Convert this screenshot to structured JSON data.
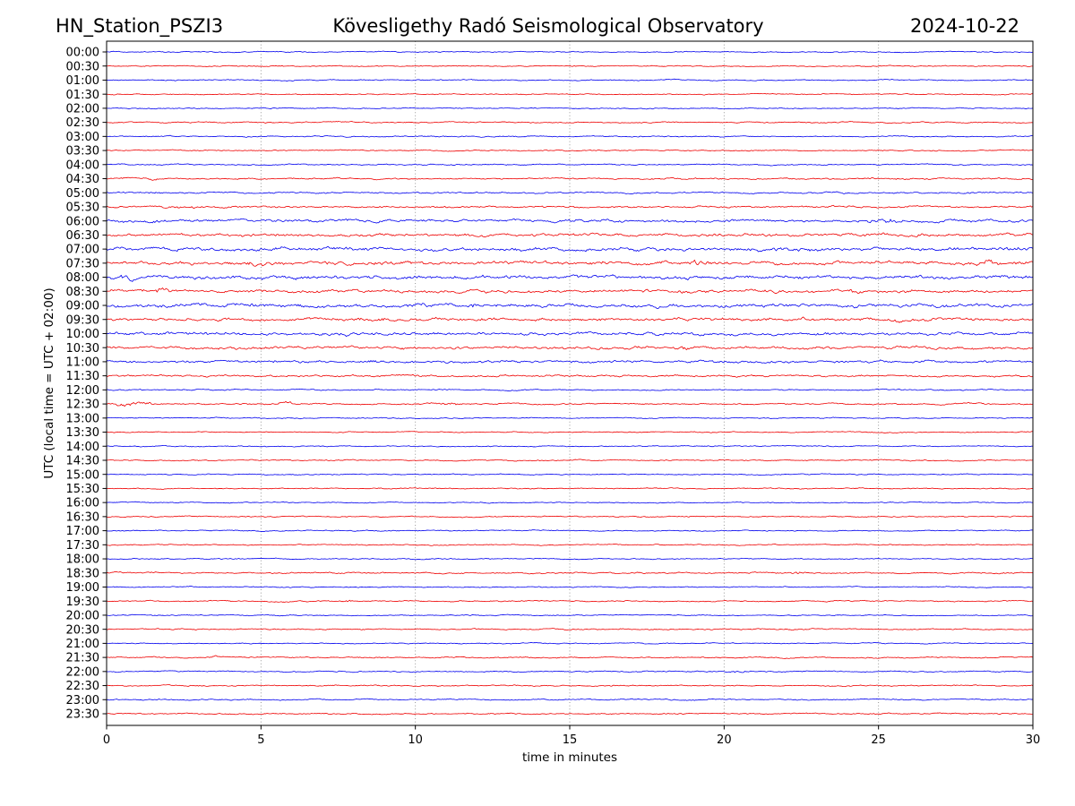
{
  "header": {
    "station": "HN_Station_PSZI3",
    "observatory": "Kövesligethy Radó Seismological Observatory",
    "date": "2024-10-22"
  },
  "chart_data": {
    "type": "line",
    "subtype": "helicorder_day_plot",
    "title": "Kövesligethy Radó Seismological Observatory",
    "station": "HN_Station_PSZI3",
    "date": "2024-10-22",
    "xlabel": "time in minutes",
    "ylabel": "UTC (local time = UTC + 02:00)",
    "xlim": [
      0,
      30
    ],
    "x_ticks": [
      0,
      5,
      10,
      15,
      20,
      25,
      30
    ],
    "minutes_per_row": 30,
    "grid": {
      "vertical": true,
      "style": "dotted",
      "positions_min": [
        5,
        10,
        15,
        20,
        25
      ]
    },
    "legend": "none",
    "colors": {
      "trace_even": "#0000ee",
      "trace_odd": "#ee0000",
      "grid": "#8c8c8c",
      "axis": "#000000",
      "text": "#000000",
      "background": "#ffffff"
    },
    "amplitude_note": "amp = relative noise amplitude (px); bursts = transient events at t minutes",
    "rows": [
      {
        "label": "00:00",
        "color": "blue",
        "amp": 0.6,
        "bursts": []
      },
      {
        "label": "00:30",
        "color": "red",
        "amp": 0.6,
        "bursts": []
      },
      {
        "label": "01:00",
        "color": "blue",
        "amp": 0.65,
        "bursts": []
      },
      {
        "label": "01:30",
        "color": "red",
        "amp": 0.6,
        "bursts": []
      },
      {
        "label": "02:00",
        "color": "blue",
        "amp": 0.6,
        "bursts": []
      },
      {
        "label": "02:30",
        "color": "red",
        "amp": 0.65,
        "bursts": []
      },
      {
        "label": "03:00",
        "color": "blue",
        "amp": 0.65,
        "bursts": []
      },
      {
        "label": "03:30",
        "color": "red",
        "amp": 0.65,
        "bursts": []
      },
      {
        "label": "04:00",
        "color": "blue",
        "amp": 0.7,
        "bursts": [
          {
            "t": 19.5,
            "dur": 0.3,
            "amp": 1.8
          }
        ]
      },
      {
        "label": "04:30",
        "color": "red",
        "amp": 0.85,
        "bursts": [
          {
            "t": 1.4,
            "dur": 0.5,
            "amp": 1.8
          }
        ]
      },
      {
        "label": "05:00",
        "color": "blue",
        "amp": 0.9,
        "bursts": [
          {
            "t": 1.8,
            "dur": 0.6,
            "amp": 1.6
          }
        ]
      },
      {
        "label": "05:30",
        "color": "red",
        "amp": 1.0,
        "bursts": [
          {
            "t": 2.4,
            "dur": 1.2,
            "amp": 1.7
          }
        ]
      },
      {
        "label": "06:00",
        "color": "blue",
        "amp": 1.5,
        "bursts": [
          {
            "t": 1.6,
            "dur": 0.5,
            "amp": 1.5
          },
          {
            "t": 25.3,
            "dur": 0.7,
            "amp": 2.1
          }
        ]
      },
      {
        "label": "06:30",
        "color": "red",
        "amp": 1.5,
        "bursts": [
          {
            "t": 25.5,
            "dur": 2.5,
            "amp": 1.3
          }
        ]
      },
      {
        "label": "07:00",
        "color": "blue",
        "amp": 1.9,
        "bursts": [
          {
            "t": 22.4,
            "dur": 0.8,
            "amp": 1.4
          }
        ]
      },
      {
        "label": "07:30",
        "color": "red",
        "amp": 2.0,
        "bursts": [
          {
            "t": 5.0,
            "dur": 1.0,
            "amp": 1.4
          },
          {
            "t": 19.0,
            "dur": 0.35,
            "amp": 2.1
          },
          {
            "t": 28.4,
            "dur": 0.5,
            "amp": 2.1
          }
        ]
      },
      {
        "label": "08:00",
        "color": "blue",
        "amp": 1.9,
        "bursts": [
          {
            "t": 0.6,
            "dur": 0.8,
            "amp": 1.7
          },
          {
            "t": 12.3,
            "dur": 0.4,
            "amp": 1.7
          }
        ]
      },
      {
        "label": "08:30",
        "color": "red",
        "amp": 1.7,
        "bursts": [
          {
            "t": 1.7,
            "dur": 0.4,
            "amp": 2.3
          },
          {
            "t": 24.2,
            "dur": 0.5,
            "amp": 1.7
          }
        ]
      },
      {
        "label": "09:00",
        "color": "blue",
        "amp": 2.0,
        "bursts": [
          {
            "t": 4.6,
            "dur": 0.4,
            "amp": 1.8
          },
          {
            "t": 11.8,
            "dur": 0.4,
            "amp": 1.8
          }
        ]
      },
      {
        "label": "09:30",
        "color": "red",
        "amp": 1.7,
        "bursts": [
          {
            "t": 9.2,
            "dur": 0.8,
            "amp": 1.6
          },
          {
            "t": 25.6,
            "dur": 0.8,
            "amp": 1.6
          }
        ]
      },
      {
        "label": "10:00",
        "color": "blue",
        "amp": 1.6,
        "bursts": [
          {
            "t": 8.0,
            "dur": 1.5,
            "amp": 1.3
          }
        ]
      },
      {
        "label": "10:30",
        "color": "red",
        "amp": 1.5,
        "bursts": [
          {
            "t": 9.7,
            "dur": 0.5,
            "amp": 1.5
          },
          {
            "t": 18.7,
            "dur": 0.3,
            "amp": 2.2
          }
        ]
      },
      {
        "label": "11:00",
        "color": "blue",
        "amp": 1.4,
        "bursts": [
          {
            "t": 5.2,
            "dur": 0.4,
            "amp": 1.9
          },
          {
            "t": 8.6,
            "dur": 0.4,
            "amp": 1.9
          }
        ]
      },
      {
        "label": "11:30",
        "color": "red",
        "amp": 1.0,
        "bursts": []
      },
      {
        "label": "12:00",
        "color": "blue",
        "amp": 0.7,
        "bursts": [
          {
            "t": 10.7,
            "dur": 0.35,
            "amp": 2.4
          },
          {
            "t": 15.5,
            "dur": 0.3,
            "amp": 1.7
          },
          {
            "t": 25.0,
            "dur": 0.4,
            "amp": 1.5
          }
        ]
      },
      {
        "label": "12:30",
        "color": "red",
        "amp": 0.75,
        "bursts": [
          {
            "t": 0.9,
            "dur": 1.3,
            "amp": 3.2
          },
          {
            "t": 5.6,
            "dur": 1.0,
            "amp": 2.4
          },
          {
            "t": 10.9,
            "dur": 1.2,
            "amp": 2.1
          },
          {
            "t": 28.0,
            "dur": 0.5,
            "amp": 1.6
          }
        ]
      },
      {
        "label": "13:00",
        "color": "blue",
        "amp": 0.6,
        "bursts": []
      },
      {
        "label": "13:30",
        "color": "red",
        "amp": 0.6,
        "bursts": []
      },
      {
        "label": "14:00",
        "color": "blue",
        "amp": 0.6,
        "bursts": []
      },
      {
        "label": "14:30",
        "color": "red",
        "amp": 0.65,
        "bursts": []
      },
      {
        "label": "15:00",
        "color": "blue",
        "amp": 0.6,
        "bursts": []
      },
      {
        "label": "15:30",
        "color": "red",
        "amp": 0.6,
        "bursts": []
      },
      {
        "label": "16:00",
        "color": "blue",
        "amp": 0.6,
        "bursts": []
      },
      {
        "label": "16:30",
        "color": "red",
        "amp": 0.65,
        "bursts": []
      },
      {
        "label": "17:00",
        "color": "blue",
        "amp": 0.6,
        "bursts": []
      },
      {
        "label": "17:30",
        "color": "red",
        "amp": 0.6,
        "bursts": []
      },
      {
        "label": "18:00",
        "color": "blue",
        "amp": 0.6,
        "bursts": []
      },
      {
        "label": "18:30",
        "color": "red",
        "amp": 0.8,
        "bursts": [
          {
            "t": 22.4,
            "dur": 0.4,
            "amp": 2.0
          }
        ]
      },
      {
        "label": "19:00",
        "color": "blue",
        "amp": 0.6,
        "bursts": []
      },
      {
        "label": "19:30",
        "color": "red",
        "amp": 0.7,
        "bursts": [
          {
            "t": 7.8,
            "dur": 0.2,
            "amp": 2.6
          }
        ]
      },
      {
        "label": "20:00",
        "color": "blue",
        "amp": 0.6,
        "bursts": []
      },
      {
        "label": "20:30",
        "color": "red",
        "amp": 0.7,
        "bursts": []
      },
      {
        "label": "21:00",
        "color": "blue",
        "amp": 0.6,
        "bursts": []
      },
      {
        "label": "21:30",
        "color": "red",
        "amp": 0.7,
        "bursts": [
          {
            "t": 3.5,
            "dur": 0.2,
            "amp": 2.0
          }
        ]
      },
      {
        "label": "22:00",
        "color": "blue",
        "amp": 0.7,
        "bursts": [
          {
            "t": 20.6,
            "dur": 0.8,
            "amp": 2.0
          }
        ]
      },
      {
        "label": "22:30",
        "color": "red",
        "amp": 0.7,
        "bursts": []
      },
      {
        "label": "23:00",
        "color": "blue",
        "amp": 0.7,
        "bursts": []
      },
      {
        "label": "23:30",
        "color": "red",
        "amp": 0.7,
        "bursts": []
      }
    ]
  }
}
